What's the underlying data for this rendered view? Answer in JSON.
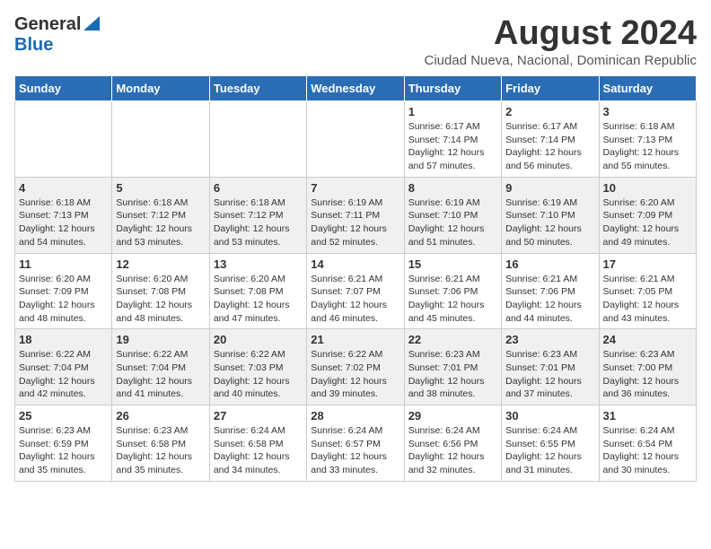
{
  "header": {
    "logo_general": "General",
    "logo_blue": "Blue",
    "title": "August 2024",
    "subtitle": "Ciudad Nueva, Nacional, Dominican Republic"
  },
  "days_of_week": [
    "Sunday",
    "Monday",
    "Tuesday",
    "Wednesday",
    "Thursday",
    "Friday",
    "Saturday"
  ],
  "weeks": [
    [
      {
        "day": "",
        "text": ""
      },
      {
        "day": "",
        "text": ""
      },
      {
        "day": "",
        "text": ""
      },
      {
        "day": "",
        "text": ""
      },
      {
        "day": "1",
        "text": "Sunrise: 6:17 AM\nSunset: 7:14 PM\nDaylight: 12 hours and 57 minutes."
      },
      {
        "day": "2",
        "text": "Sunrise: 6:17 AM\nSunset: 7:14 PM\nDaylight: 12 hours and 56 minutes."
      },
      {
        "day": "3",
        "text": "Sunrise: 6:18 AM\nSunset: 7:13 PM\nDaylight: 12 hours and 55 minutes."
      }
    ],
    [
      {
        "day": "4",
        "text": "Sunrise: 6:18 AM\nSunset: 7:13 PM\nDaylight: 12 hours and 54 minutes."
      },
      {
        "day": "5",
        "text": "Sunrise: 6:18 AM\nSunset: 7:12 PM\nDaylight: 12 hours and 53 minutes."
      },
      {
        "day": "6",
        "text": "Sunrise: 6:18 AM\nSunset: 7:12 PM\nDaylight: 12 hours and 53 minutes."
      },
      {
        "day": "7",
        "text": "Sunrise: 6:19 AM\nSunset: 7:11 PM\nDaylight: 12 hours and 52 minutes."
      },
      {
        "day": "8",
        "text": "Sunrise: 6:19 AM\nSunset: 7:10 PM\nDaylight: 12 hours and 51 minutes."
      },
      {
        "day": "9",
        "text": "Sunrise: 6:19 AM\nSunset: 7:10 PM\nDaylight: 12 hours and 50 minutes."
      },
      {
        "day": "10",
        "text": "Sunrise: 6:20 AM\nSunset: 7:09 PM\nDaylight: 12 hours and 49 minutes."
      }
    ],
    [
      {
        "day": "11",
        "text": "Sunrise: 6:20 AM\nSunset: 7:09 PM\nDaylight: 12 hours and 48 minutes."
      },
      {
        "day": "12",
        "text": "Sunrise: 6:20 AM\nSunset: 7:08 PM\nDaylight: 12 hours and 48 minutes."
      },
      {
        "day": "13",
        "text": "Sunrise: 6:20 AM\nSunset: 7:08 PM\nDaylight: 12 hours and 47 minutes."
      },
      {
        "day": "14",
        "text": "Sunrise: 6:21 AM\nSunset: 7:07 PM\nDaylight: 12 hours and 46 minutes."
      },
      {
        "day": "15",
        "text": "Sunrise: 6:21 AM\nSunset: 7:06 PM\nDaylight: 12 hours and 45 minutes."
      },
      {
        "day": "16",
        "text": "Sunrise: 6:21 AM\nSunset: 7:06 PM\nDaylight: 12 hours and 44 minutes."
      },
      {
        "day": "17",
        "text": "Sunrise: 6:21 AM\nSunset: 7:05 PM\nDaylight: 12 hours and 43 minutes."
      }
    ],
    [
      {
        "day": "18",
        "text": "Sunrise: 6:22 AM\nSunset: 7:04 PM\nDaylight: 12 hours and 42 minutes."
      },
      {
        "day": "19",
        "text": "Sunrise: 6:22 AM\nSunset: 7:04 PM\nDaylight: 12 hours and 41 minutes."
      },
      {
        "day": "20",
        "text": "Sunrise: 6:22 AM\nSunset: 7:03 PM\nDaylight: 12 hours and 40 minutes."
      },
      {
        "day": "21",
        "text": "Sunrise: 6:22 AM\nSunset: 7:02 PM\nDaylight: 12 hours and 39 minutes."
      },
      {
        "day": "22",
        "text": "Sunrise: 6:23 AM\nSunset: 7:01 PM\nDaylight: 12 hours and 38 minutes."
      },
      {
        "day": "23",
        "text": "Sunrise: 6:23 AM\nSunset: 7:01 PM\nDaylight: 12 hours and 37 minutes."
      },
      {
        "day": "24",
        "text": "Sunrise: 6:23 AM\nSunset: 7:00 PM\nDaylight: 12 hours and 36 minutes."
      }
    ],
    [
      {
        "day": "25",
        "text": "Sunrise: 6:23 AM\nSunset: 6:59 PM\nDaylight: 12 hours and 35 minutes."
      },
      {
        "day": "26",
        "text": "Sunrise: 6:23 AM\nSunset: 6:58 PM\nDaylight: 12 hours and 35 minutes."
      },
      {
        "day": "27",
        "text": "Sunrise: 6:24 AM\nSunset: 6:58 PM\nDaylight: 12 hours and 34 minutes."
      },
      {
        "day": "28",
        "text": "Sunrise: 6:24 AM\nSunset: 6:57 PM\nDaylight: 12 hours and 33 minutes."
      },
      {
        "day": "29",
        "text": "Sunrise: 6:24 AM\nSunset: 6:56 PM\nDaylight: 12 hours and 32 minutes."
      },
      {
        "day": "30",
        "text": "Sunrise: 6:24 AM\nSunset: 6:55 PM\nDaylight: 12 hours and 31 minutes."
      },
      {
        "day": "31",
        "text": "Sunrise: 6:24 AM\nSunset: 6:54 PM\nDaylight: 12 hours and 30 minutes."
      }
    ]
  ]
}
